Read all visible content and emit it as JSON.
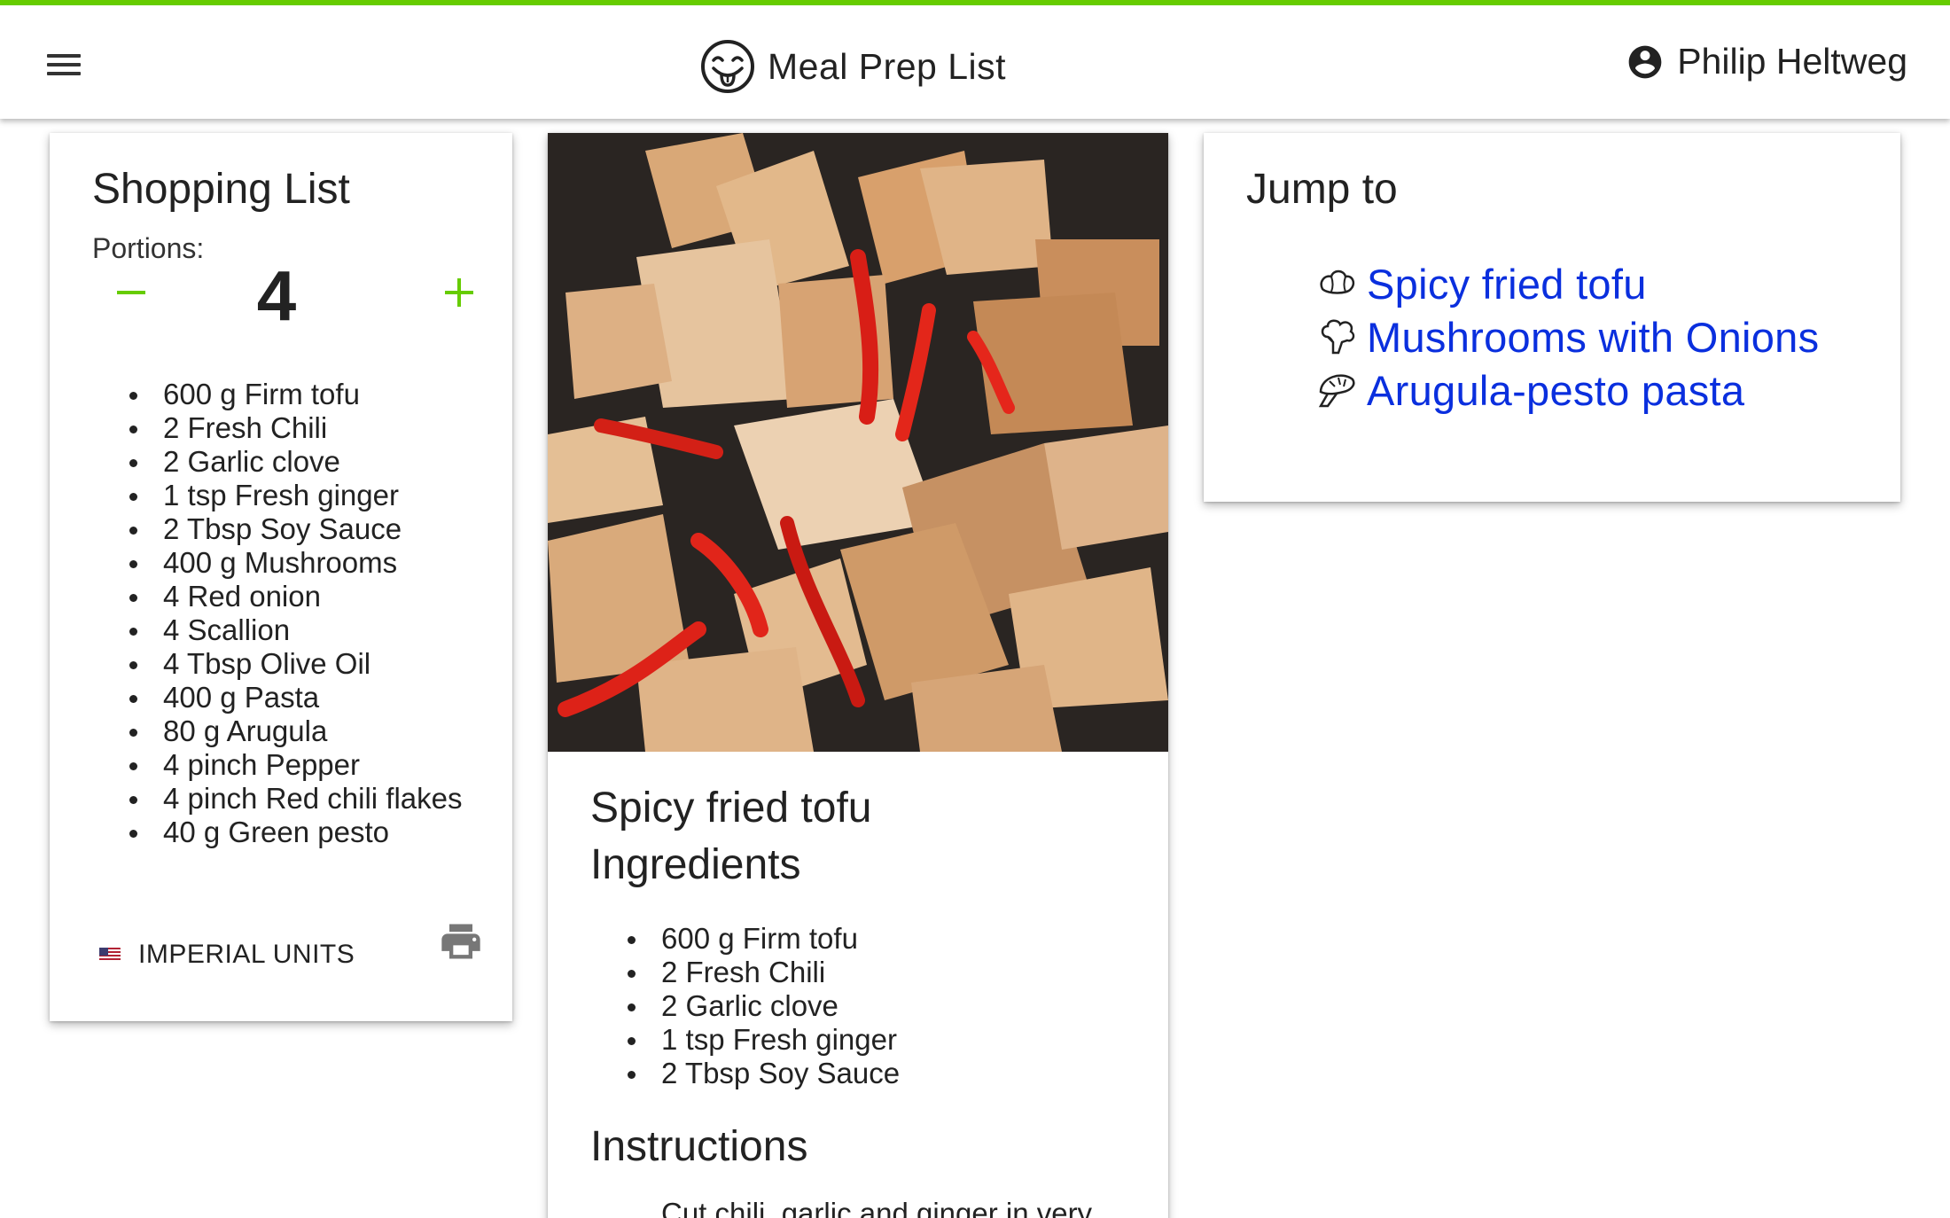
{
  "theme": {
    "accent": "#66cc00",
    "link": "#0a2fde"
  },
  "header": {
    "menu_icon": "menu-icon",
    "logo_icon": "smiley-tongue-icon",
    "title": "Meal Prep List",
    "user_icon": "account-circle-icon",
    "user_name": "Philip Heltweg"
  },
  "shopping": {
    "title": "Shopping List",
    "portions_label": "Portions:",
    "portions": "4",
    "items": [
      "600 g Firm tofu",
      "2 Fresh Chili",
      "2 Garlic clove",
      "1 tsp Fresh ginger",
      "2 Tbsp Soy Sauce",
      "400 g Mushrooms",
      "4 Red onion",
      "4 Scallion",
      "4 Tbsp Olive Oil",
      "400 g Pasta",
      "80 g Arugula",
      "4 pinch Pepper",
      "4 pinch Red chili flakes",
      "40 g Green pesto"
    ],
    "units_button": "IMPERIAL UNITS",
    "units_icon": "us-flag-icon",
    "print_icon": "print-icon"
  },
  "recipe": {
    "title_line1": "Spicy fried tofu",
    "title_line2": "Ingredients",
    "ingredients": [
      "600 g Firm tofu",
      "2 Fresh Chili",
      "2 Garlic clove",
      "1 tsp Fresh ginger",
      "2 Tbsp Soy Sauce"
    ],
    "instructions_title": "Instructions",
    "instruction_first": "Cut chili, garlic and ginger in very"
  },
  "jump": {
    "title": "Jump to",
    "links": [
      {
        "label": "Spicy fried tofu",
        "icon": "tofu-icon"
      },
      {
        "label": "Mushrooms with Onions",
        "icon": "broccoli-icon"
      },
      {
        "label": "Arugula-pesto pasta",
        "icon": "mushroom-icon"
      }
    ]
  }
}
